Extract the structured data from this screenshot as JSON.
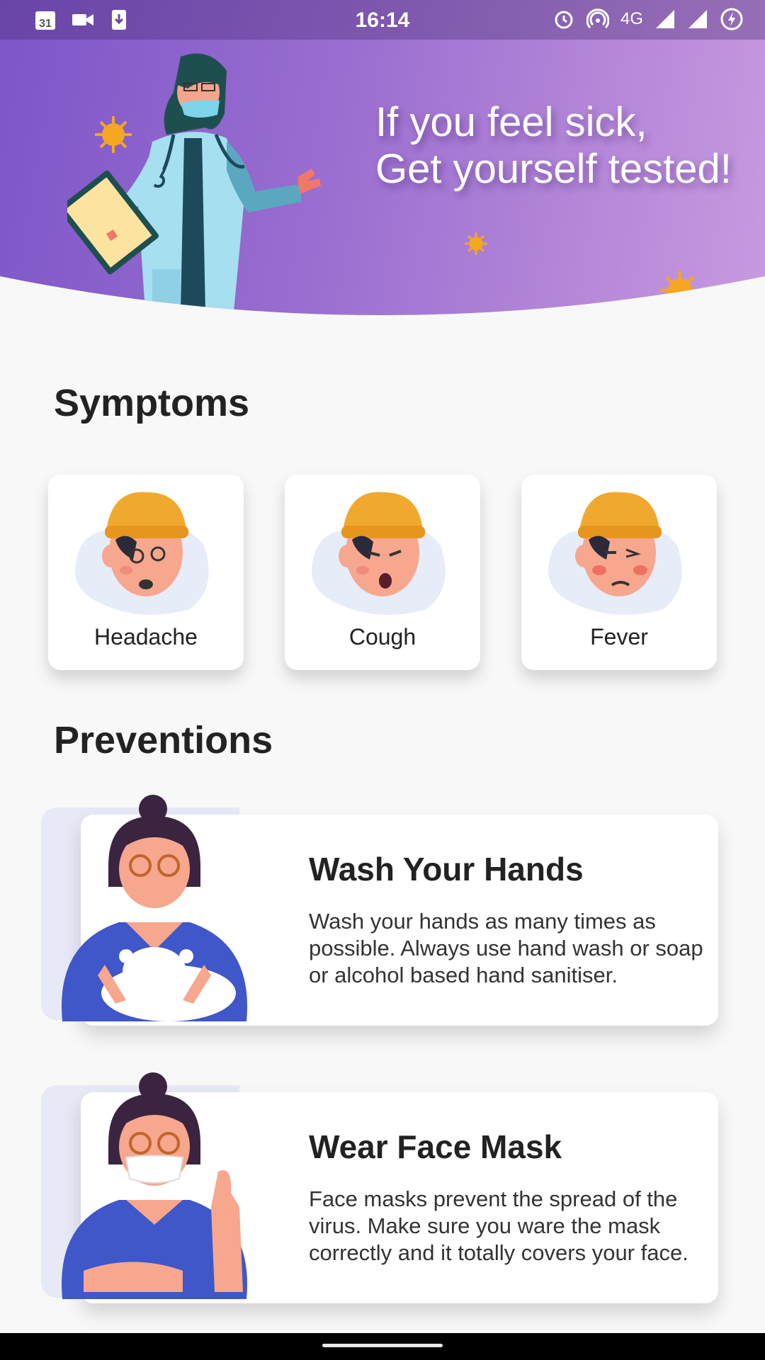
{
  "status_bar": {
    "time": "16:14",
    "calendar_day": "31",
    "network": "4G"
  },
  "header": {
    "headline_line1": "If you feel sick,",
    "headline_line2": "Get yourself tested!"
  },
  "symptoms": {
    "title": "Symptoms",
    "items": [
      {
        "label": "Headache"
      },
      {
        "label": "Cough"
      },
      {
        "label": "Fever"
      }
    ]
  },
  "preventions": {
    "title": "Preventions",
    "items": [
      {
        "title": "Wash Your Hands",
        "text": "Wash your hands as many times as possible. Always use hand wash or soap or alcohol based hand sanitiser."
      },
      {
        "title": "Wear Face Mask",
        "text": "Face masks prevent the spread of the virus. Make sure you ware the mask correctly and it totally covers your face."
      }
    ]
  },
  "colors": {
    "header_start": "#7d55c8",
    "header_end": "#c89ae0",
    "virus": "#f5a623",
    "hat": "#f0a92e",
    "shirt": "#3f57c9"
  },
  "icons": [
    "calendar-icon",
    "video-icon",
    "download-icon",
    "alarm-icon",
    "hotspot-icon",
    "signal-icon",
    "battery-saver-icon"
  ]
}
